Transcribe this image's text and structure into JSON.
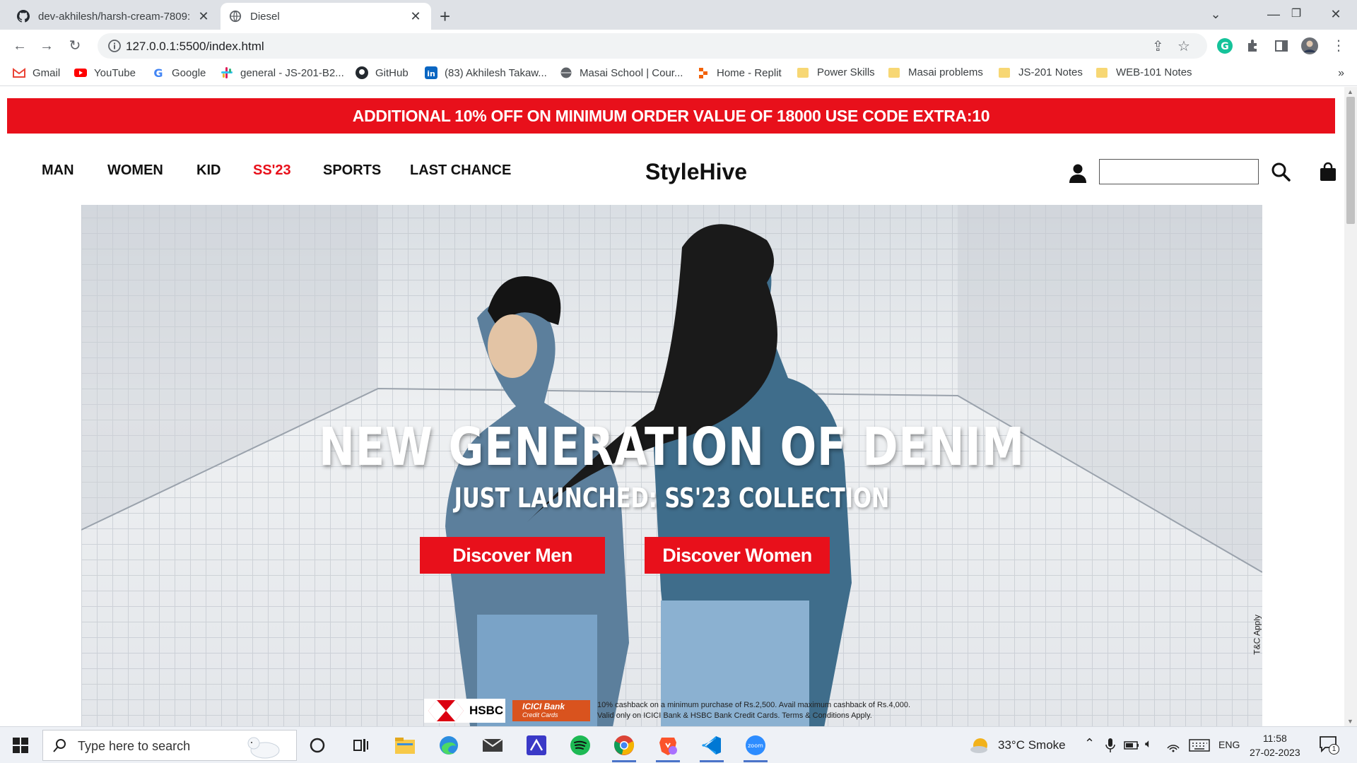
{
  "browser": {
    "tabs": [
      {
        "title": "dev-akhilesh/harsh-cream-7809:",
        "active": false
      },
      {
        "title": "Diesel",
        "active": true
      }
    ],
    "url": "127.0.0.1:5500/index.html",
    "bookmarks": [
      {
        "label": "Gmail",
        "icon": "gmail-icon"
      },
      {
        "label": "YouTube",
        "icon": "youtube-icon"
      },
      {
        "label": "Google",
        "icon": "google-icon"
      },
      {
        "label": "general - JS-201-B2...",
        "icon": "slack-icon"
      },
      {
        "label": "GitHub",
        "icon": "github-icon"
      },
      {
        "label": "(83) Akhilesh Takaw...",
        "icon": "linkedin-icon"
      },
      {
        "label": "Masai School | Cour...",
        "icon": "globe-icon"
      },
      {
        "label": "Home - Replit",
        "icon": "replit-icon"
      },
      {
        "label": "Power Skills",
        "icon": "folder-icon"
      },
      {
        "label": "Masai problems",
        "icon": "folder-icon"
      },
      {
        "label": "JS-201 Notes",
        "icon": "folder-icon"
      },
      {
        "label": "WEB-101 Notes",
        "icon": "folder-icon"
      }
    ],
    "more": "»"
  },
  "page": {
    "promo": "ADDITIONAL 10% OFF ON MINIMUM ORDER VALUE OF 18000 USE CODE EXTRA:10",
    "nav": [
      "MAN",
      "WOMEN",
      "KID",
      "SS'23",
      "SPORTS",
      "LAST CHANCE"
    ],
    "brand": "StyleHive",
    "search_value": "",
    "hero": {
      "headline": "NEW GENERATION OF DENIM",
      "subheadline": "JUST LAUNCHED: SS'23 COLLECTION",
      "cta_men": "Discover Men",
      "cta_women": "Discover Women",
      "tc": "T&C Apply",
      "bank_hsbc": "HSBC",
      "bank_icici_1": "ICICI Bank",
      "bank_icici_2": "Credit Cards",
      "bank_note_1": "10% cashback on a minimum purchase of Rs.2,500. Avail maximum cashback of Rs.4,000.",
      "bank_note_2": "Valid only on ICICI Bank & HSBC Bank Credit Cards. Terms & Conditions Apply."
    },
    "accent_color": "#e8101b"
  },
  "taskbar": {
    "search_placeholder": "Type here to search",
    "weather": "33°C  Smoke",
    "lang": "ENG",
    "time": "11:58",
    "date": "27-02-2023",
    "notifications": "1"
  }
}
